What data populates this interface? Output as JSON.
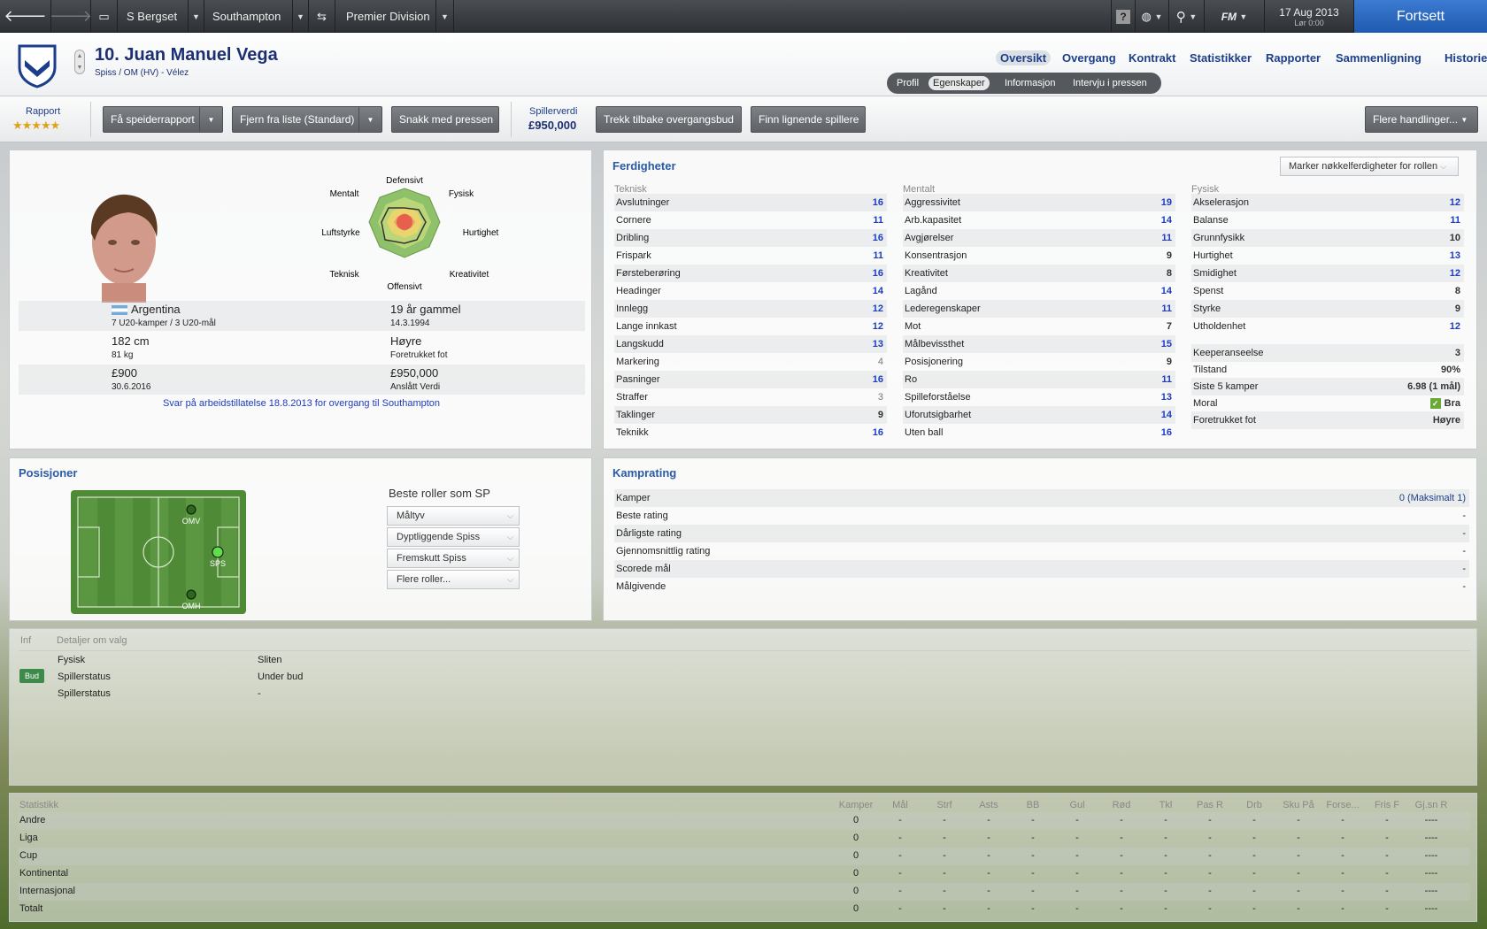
{
  "topbar": {
    "manager": "S Bergset",
    "club": "Southampton",
    "league": "Premier Division",
    "date": "17 Aug 2013",
    "time": "Lør 0:00",
    "continue_label": "Fortsett",
    "help_label": "?",
    "fm_label": "FM"
  },
  "player": {
    "name": "10. Juan Manuel Vega",
    "subtitle": "Spiss / OM (HV) - Vélez"
  },
  "nav_tabs": [
    "Oversikt",
    "Overgang",
    "Kontrakt",
    "Statistikker",
    "Rapporter",
    "Sammenligning",
    "Historie"
  ],
  "sub_tabs": [
    "Profil",
    "Egenskaper",
    "Informasjon",
    "Intervju i pressen"
  ],
  "actions": {
    "report_label": "Rapport",
    "report_stars": "★★★★★",
    "scout_button": "Få speiderrapport",
    "remove_button": "Fjern fra liste (Standard)",
    "press_button": "Snakk med pressen",
    "value_label": "Spillerverdi",
    "value": "£950,000",
    "withdraw_button": "Trekk tilbake overgangsbud",
    "similar_button": "Finn lignende spillere",
    "more_actions": "Flere handlinger..."
  },
  "profile": {
    "radar_labels": {
      "top": "Defensivt",
      "top_left": "Mentalt",
      "top_right": "Fysisk",
      "left": "Luftstyrke",
      "right": "Hurtighet",
      "bottom_left": "Teknisk",
      "bottom_right": "Kreativitet",
      "bottom": "Offensivt"
    },
    "nationality": "Argentina",
    "caps": "7 U20-kamper / 3 U20-mål",
    "age": "19 år gammel",
    "dob": "14.3.1994",
    "height": "182 cm",
    "weight": "81 kg",
    "foot": "Høyre",
    "foot_label": "Foretrukket fot",
    "wage": "£900",
    "contract_end": "30.6.2016",
    "est_value": "£950,000",
    "est_value_label": "Anslått Verdi",
    "work_permit": "Svar på arbeidstillatelse 18.8.2013 for overgang til Southampton"
  },
  "skills": {
    "title": "Ferdigheter",
    "mark_button": "Marker nøkkelferdigheter for rollen",
    "technical_header": "Teknisk",
    "mental_header": "Mentalt",
    "physical_header": "Fysisk",
    "technical": [
      {
        "name": "Avslutninger",
        "value": "16"
      },
      {
        "name": "Cornere",
        "value": "11"
      },
      {
        "name": "Dribling",
        "value": "16"
      },
      {
        "name": "Frispark",
        "value": "11"
      },
      {
        "name": "Førsteberøring",
        "value": "16"
      },
      {
        "name": "Headinger",
        "value": "14"
      },
      {
        "name": "Innlegg",
        "value": "12"
      },
      {
        "name": "Lange innkast",
        "value": "12"
      },
      {
        "name": "Langskudd",
        "value": "13"
      },
      {
        "name": "Markering",
        "value": "4"
      },
      {
        "name": "Pasninger",
        "value": "16"
      },
      {
        "name": "Straffer",
        "value": "3"
      },
      {
        "name": "Taklinger",
        "value": "9"
      },
      {
        "name": "Teknikk",
        "value": "16"
      }
    ],
    "mental": [
      {
        "name": "Aggressivitet",
        "value": "19"
      },
      {
        "name": "Arb.kapasitet",
        "value": "14"
      },
      {
        "name": "Avgjørelser",
        "value": "11"
      },
      {
        "name": "Konsentrasjon",
        "value": "9"
      },
      {
        "name": "Kreativitet",
        "value": "8"
      },
      {
        "name": "Lagånd",
        "value": "14"
      },
      {
        "name": "Lederegenskaper",
        "value": "11"
      },
      {
        "name": "Mot",
        "value": "7"
      },
      {
        "name": "Målbevissthet",
        "value": "15"
      },
      {
        "name": "Posisjonering",
        "value": "9"
      },
      {
        "name": "Ro",
        "value": "11"
      },
      {
        "name": "Spilleforståelse",
        "value": "13"
      },
      {
        "name": "Uforutsigbarhet",
        "value": "14"
      },
      {
        "name": "Uten ball",
        "value": "16"
      }
    ],
    "physical": [
      {
        "name": "Akselerasjon",
        "value": "12"
      },
      {
        "name": "Balanse",
        "value": "11"
      },
      {
        "name": "Grunnfysikk",
        "value": "10"
      },
      {
        "name": "Hurtighet",
        "value": "13"
      },
      {
        "name": "Smidighet",
        "value": "12"
      },
      {
        "name": "Spenst",
        "value": "8"
      },
      {
        "name": "Styrke",
        "value": "9"
      },
      {
        "name": "Utholdenhet",
        "value": "12"
      }
    ],
    "extra": [
      {
        "name": "Keeperanseelse",
        "value": "3"
      },
      {
        "name": "Tilstand",
        "value": "90%"
      },
      {
        "name": "Siste 5 kamper",
        "value": "6.98 (1 mål)"
      },
      {
        "name": "Moral",
        "value": "Bra"
      },
      {
        "name": "Foretrukket fot",
        "value": "Høyre"
      }
    ]
  },
  "positions": {
    "title": "Posisjoner",
    "markers": [
      "OMV",
      "SPS",
      "OMH"
    ],
    "best_roles_title": "Beste roller som SP",
    "roles": [
      "Måltyv",
      "Dyptliggende Spiss",
      "Fremskutt Spiss",
      "Flere roller..."
    ]
  },
  "match_rating": {
    "title": "Kamprating",
    "rows": [
      {
        "label": "Kamper",
        "value": "0 (Maksimalt 1)"
      },
      {
        "label": "Beste rating",
        "value": "-"
      },
      {
        "label": "Dårligste rating",
        "value": "-"
      },
      {
        "label": "Gjennomsnittlig rating",
        "value": "-"
      },
      {
        "label": "Scorede mål",
        "value": "-"
      },
      {
        "label": "Målgivende",
        "value": "-"
      }
    ]
  },
  "info": {
    "col_inf": "Inf",
    "col_details": "Detaljer om valg",
    "badge": "Bud",
    "rows": [
      {
        "label": "Fysisk",
        "value": "Sliten"
      },
      {
        "label": "Spillerstatus",
        "value": "Under bud"
      },
      {
        "label": "Spillerstatus",
        "value": "-"
      }
    ]
  },
  "stats": {
    "title": "Statistikk",
    "columns": [
      "Kamper",
      "Mål",
      "Strf",
      "Asts",
      "BB",
      "Gul",
      "Rød",
      "Tkl",
      "Pas R",
      "Drb",
      "Sku På",
      "Forse...",
      "Fris F",
      "Gj.sn R"
    ],
    "rows": [
      {
        "label": "Andre",
        "values": [
          "0",
          "-",
          "-",
          "-",
          "-",
          "-",
          "-",
          "-",
          "-",
          "-",
          "-",
          "-",
          "-",
          "----"
        ]
      },
      {
        "label": "Liga",
        "values": [
          "0",
          "-",
          "-",
          "-",
          "-",
          "-",
          "-",
          "-",
          "-",
          "-",
          "-",
          "-",
          "-",
          "----"
        ]
      },
      {
        "label": "Cup",
        "values": [
          "0",
          "-",
          "-",
          "-",
          "-",
          "-",
          "-",
          "-",
          "-",
          "-",
          "-",
          "-",
          "-",
          "----"
        ]
      },
      {
        "label": "Kontinental",
        "values": [
          "0",
          "-",
          "-",
          "-",
          "-",
          "-",
          "-",
          "-",
          "-",
          "-",
          "-",
          "-",
          "-",
          "----"
        ]
      },
      {
        "label": "Internasjonal",
        "values": [
          "0",
          "-",
          "-",
          "-",
          "-",
          "-",
          "-",
          "-",
          "-",
          "-",
          "-",
          "-",
          "-",
          "----"
        ]
      },
      {
        "label": "Totalt",
        "values": [
          "0",
          "-",
          "-",
          "-",
          "-",
          "-",
          "-",
          "-",
          "-",
          "-",
          "-",
          "-",
          "-",
          "----"
        ]
      }
    ]
  }
}
